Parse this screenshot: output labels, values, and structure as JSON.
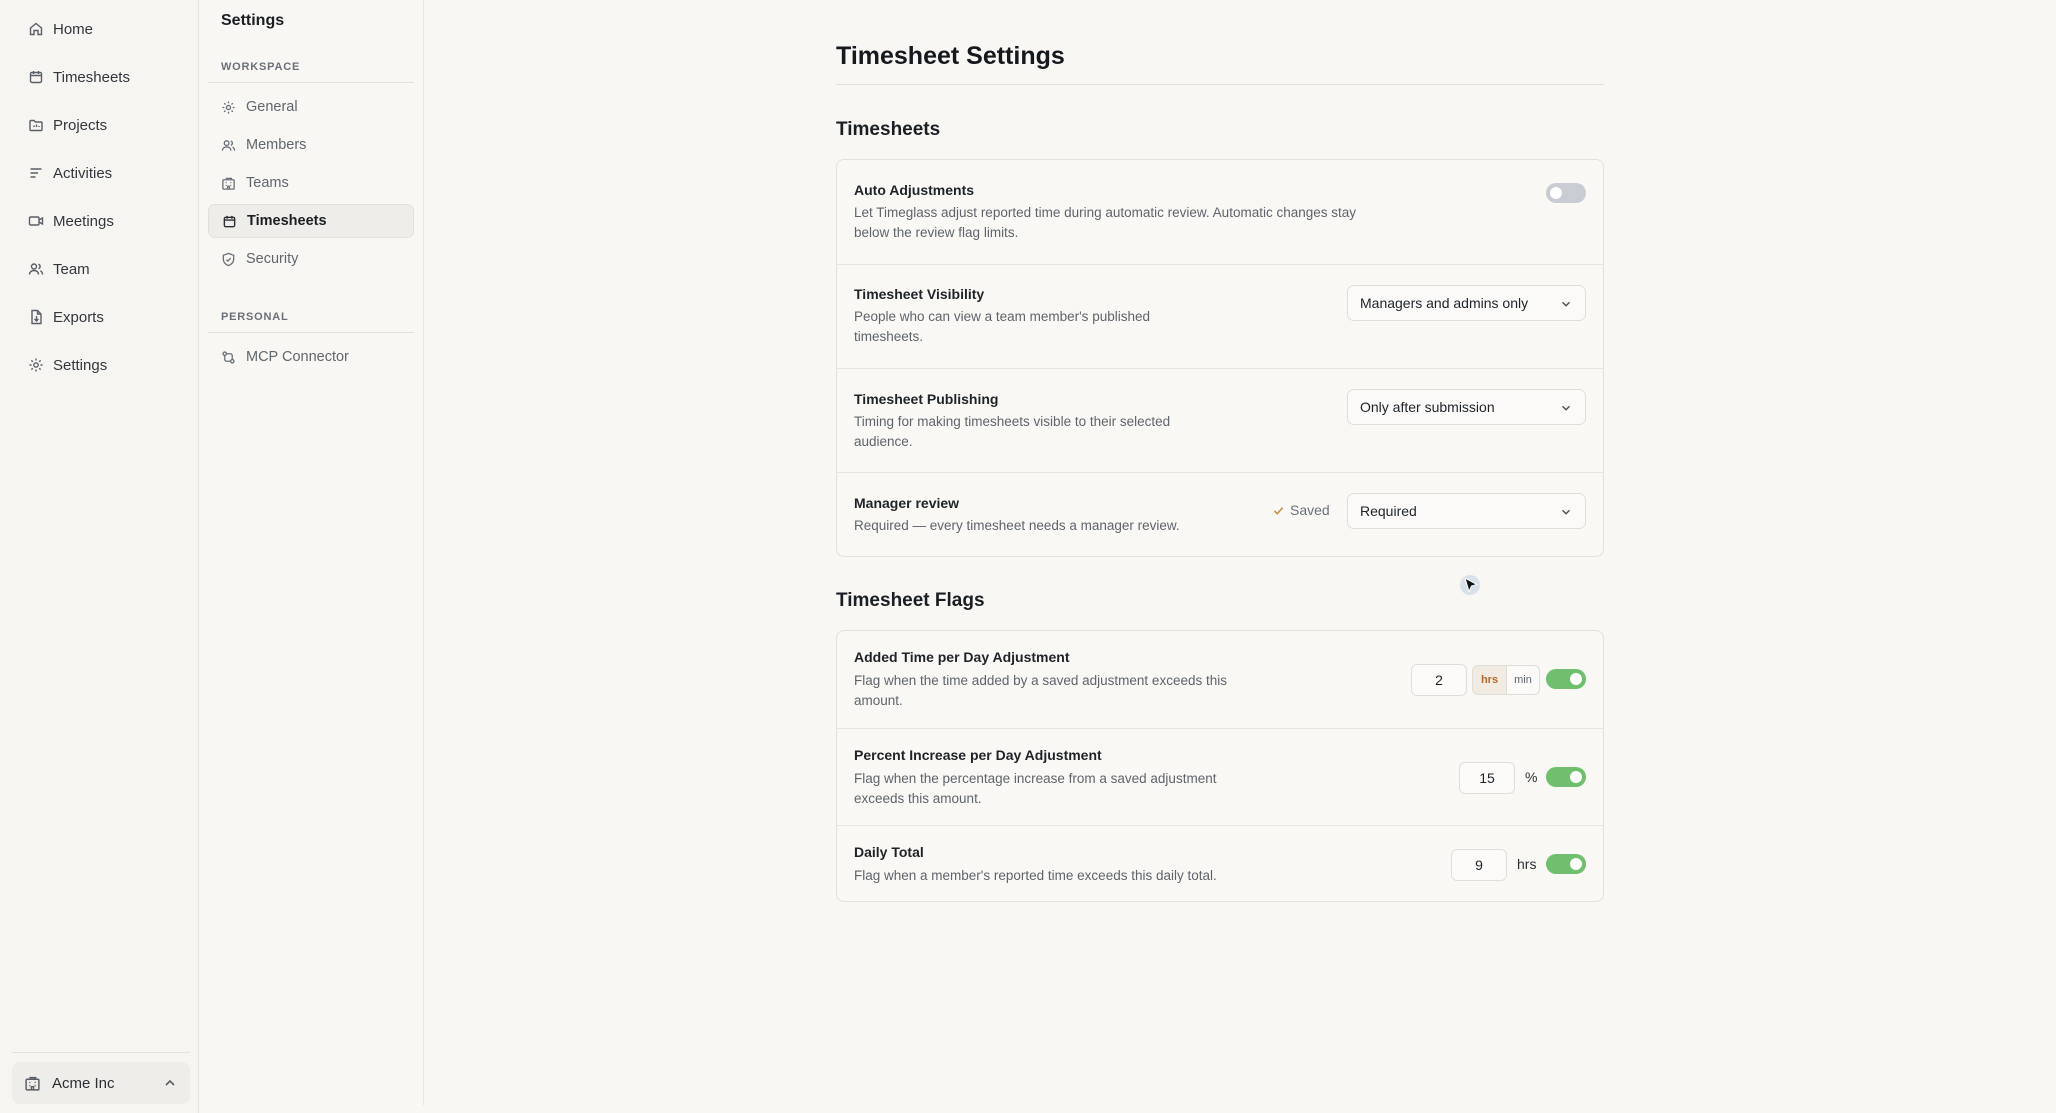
{
  "sidebar": {
    "items": [
      {
        "label": "Home",
        "icon": "home-icon"
      },
      {
        "label": "Timesheets",
        "icon": "calendar-icon"
      },
      {
        "label": "Projects",
        "icon": "folder-icon"
      },
      {
        "label": "Activities",
        "icon": "list-icon"
      },
      {
        "label": "Meetings",
        "icon": "video-icon"
      },
      {
        "label": "Team",
        "icon": "users-icon"
      },
      {
        "label": "Exports",
        "icon": "file-export-icon"
      },
      {
        "label": "Settings",
        "icon": "gear-icon"
      }
    ],
    "workspace": {
      "label": "Acme Inc",
      "icon": "building-icon"
    }
  },
  "settings_nav": {
    "title": "Settings",
    "workspace_label": "WORKSPACE",
    "workspace_items": [
      {
        "label": "General",
        "icon": "gear-icon"
      },
      {
        "label": "Members",
        "icon": "users-icon"
      },
      {
        "label": "Teams",
        "icon": "building-icon"
      },
      {
        "label": "Timesheets",
        "icon": "calendar-icon",
        "active": true
      },
      {
        "label": "Security",
        "icon": "shield-icon"
      }
    ],
    "personal_label": "PERSONAL",
    "personal_items": [
      {
        "label": "MCP Connector",
        "icon": "connector-icon"
      }
    ]
  },
  "page": {
    "title": "Timesheet Settings",
    "timesheets_section": {
      "title": "Timesheets",
      "auto_adjustments": {
        "title": "Auto Adjustments",
        "desc_line1": "Let Timeglass adjust reported time during automatic review. Automatic changes stay",
        "desc_line2": "below the review flag limits.",
        "enabled": false
      },
      "visibility": {
        "title": "Timesheet Visibility",
        "desc_line1": "People who can view a team member's published",
        "desc_line2": "timesheets.",
        "value": "Managers and admins only"
      },
      "publishing": {
        "title": "Timesheet Publishing",
        "desc_line1": "Timing for making timesheets visible to their selected",
        "desc_line2": "audience.",
        "value": "Only after submission"
      },
      "manager_review": {
        "title": "Manager review",
        "desc": "Required — every timesheet needs a manager review.",
        "saved_label": "Saved",
        "value": "Required"
      }
    },
    "flags_section": {
      "title": "Timesheet Flags",
      "added_time": {
        "title": "Added Time per Day Adjustment",
        "desc_line1": "Flag when the time added by a saved adjustment exceeds this",
        "desc_line2": "amount.",
        "value": "2",
        "unit_hrs": "hrs",
        "unit_min": "min",
        "enabled": true
      },
      "percent_increase": {
        "title": "Percent Increase per Day Adjustment",
        "desc_line1": "Flag when the percentage increase from a saved adjustment",
        "desc_line2": "exceeds this amount.",
        "value": "15",
        "unit": "%",
        "enabled": true
      },
      "daily_total": {
        "title": "Daily Total",
        "desc": "Flag when a member's reported time exceeds this daily total.",
        "value": "9",
        "unit": "hrs",
        "enabled": true
      }
    }
  },
  "colors": {
    "toggle_on": "#6fbf6e",
    "toggle_off": "#c9ccd3",
    "accent_orange": "#b4692a"
  }
}
